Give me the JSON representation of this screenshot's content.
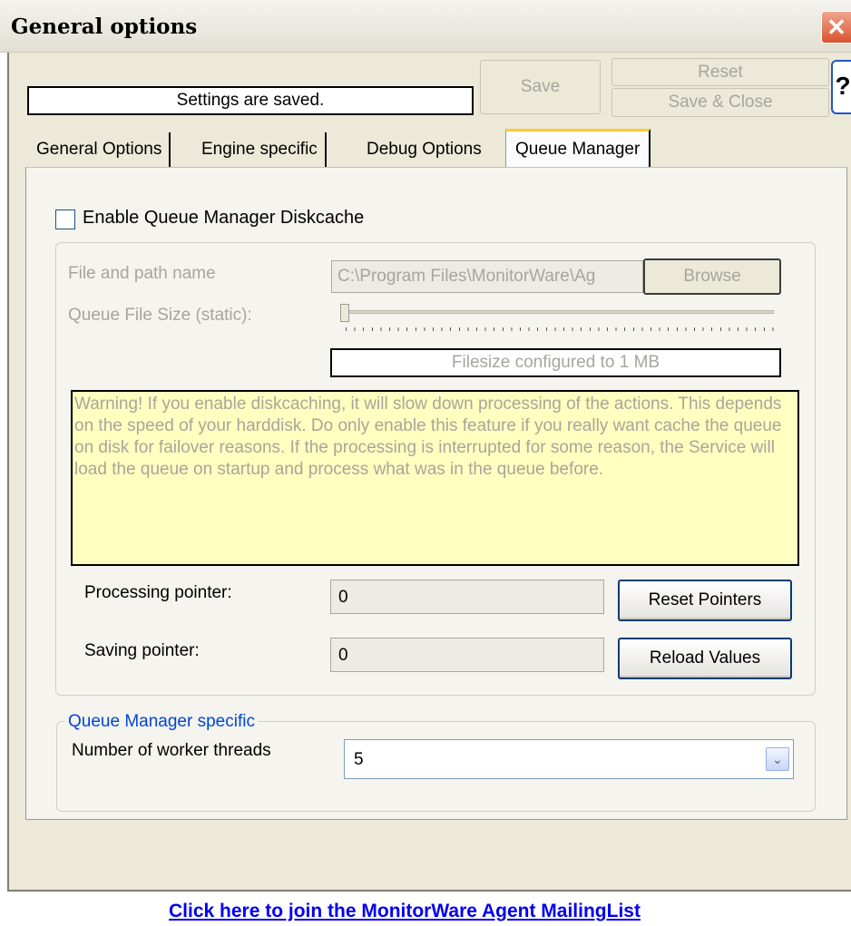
{
  "window": {
    "title": "General options",
    "close_glyph": "✕",
    "help_glyph": "?"
  },
  "toolbar": {
    "status_text": "Settings are saved.",
    "save_label": "Save",
    "reset_label": "Reset",
    "save_close_label": "Save & Close"
  },
  "tabs": [
    {
      "label": "General Options",
      "active": false
    },
    {
      "label": "Engine specific",
      "active": false
    },
    {
      "label": "Debug Options",
      "active": false
    },
    {
      "label": "Queue Manager",
      "active": true
    }
  ],
  "queue": {
    "enable_label": "Enable Queue Manager Diskcache",
    "enable_checked": false,
    "file_label": "File and path name",
    "file_value": "C:\\Program Files\\MonitorWare\\Ag",
    "browse_label": "Browse",
    "size_label": "Queue File Size (static):",
    "size_level": 0,
    "filesize_text": "Filesize configured to 1 MB",
    "warning_text": "Warning! If you enable diskcaching, it will slow down processing of the actions. This depends on the speed of your harddisk. Do only enable this feature if you really want cache the queue on disk for failover reasons. If the processing is interrupted for some reason, the Service will load the queue on startup and process what was in the queue before.",
    "processing_label": "Processing pointer:",
    "processing_value": "0",
    "saving_label": "Saving pointer:",
    "saving_value": "0",
    "reset_pointers_label": "Reset Pointers",
    "reload_values_label": "Reload Values"
  },
  "specific": {
    "group_title": "Queue Manager specific",
    "workers_label": "Number of worker threads",
    "workers_value": "5",
    "dropdown_glyph": "⌄"
  },
  "footer": {
    "link_text": "Click here to join the MonitorWare Agent MailingList"
  }
}
